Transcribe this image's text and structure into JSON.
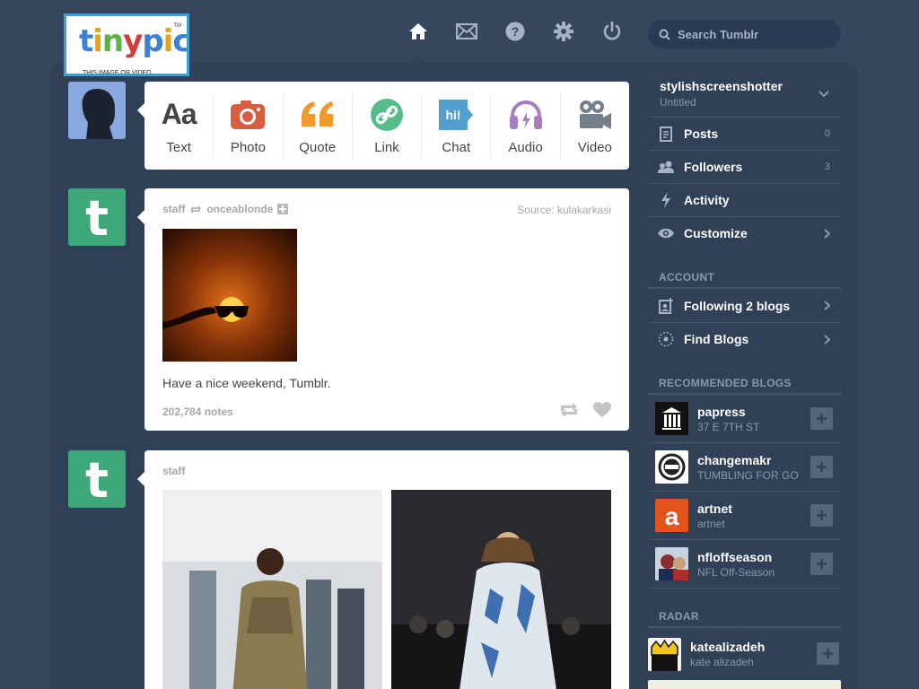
{
  "logo": {
    "text": "tinypic",
    "caption": "THIS IMAGE OR VIDEO"
  },
  "search": {
    "placeholder": "Search Tumblr"
  },
  "nav": {
    "icons": [
      "home-icon",
      "mail-icon",
      "help-icon",
      "gear-icon",
      "power-icon"
    ]
  },
  "post_types": [
    {
      "label": "Text",
      "glyph": "Aa",
      "color": "#444444"
    },
    {
      "label": "Photo",
      "color": "#d95e40"
    },
    {
      "label": "Quote",
      "glyph": "“",
      "color": "#f2992e"
    },
    {
      "label": "Link",
      "color": "#56bc8a"
    },
    {
      "label": "Chat",
      "glyph": "hi!",
      "color": "#529ecc"
    },
    {
      "label": "Audio",
      "color": "#a77dc2"
    },
    {
      "label": "Video",
      "color": "#748089"
    }
  ],
  "posts": [
    {
      "author": "staff",
      "reblogged_from": "onceablonde",
      "source": "Source: kulakarkasi",
      "caption": "Have a nice weekend, Tumblr.",
      "notes": "202,784 notes"
    },
    {
      "author": "staff"
    }
  ],
  "sidebar": {
    "blog": {
      "name": "stylishscreenshotter",
      "subtitle": "Untitled"
    },
    "items": [
      {
        "label": "Posts",
        "count": "0"
      },
      {
        "label": "Followers",
        "count": "3"
      },
      {
        "label": "Activity"
      },
      {
        "label": "Customize"
      }
    ],
    "account_heading": "ACCOUNT",
    "account_items": [
      {
        "label": "Following 2 blogs"
      },
      {
        "label": "Find Blogs"
      }
    ],
    "recommended_heading": "RECOMMENDED BLOGS",
    "recommended": [
      {
        "name": "papress",
        "sub": "37 E 7TH ST",
        "color": "#111111"
      },
      {
        "name": "changemakr",
        "sub": "TUMBLING FOR GO",
        "color": "#ffffff"
      },
      {
        "name": "artnet",
        "sub": "artnet",
        "color": "#e2541c"
      },
      {
        "name": "nfloffseason",
        "sub": "NFL Off-Season",
        "color": "#c9d3e0"
      }
    ],
    "radar_heading": "RADAR",
    "radar": {
      "name": "katealizadeh",
      "sub": "kate alizadeh"
    }
  },
  "colors": {
    "bg": "#36465d",
    "accent_tumblr": "#3ea87a"
  }
}
